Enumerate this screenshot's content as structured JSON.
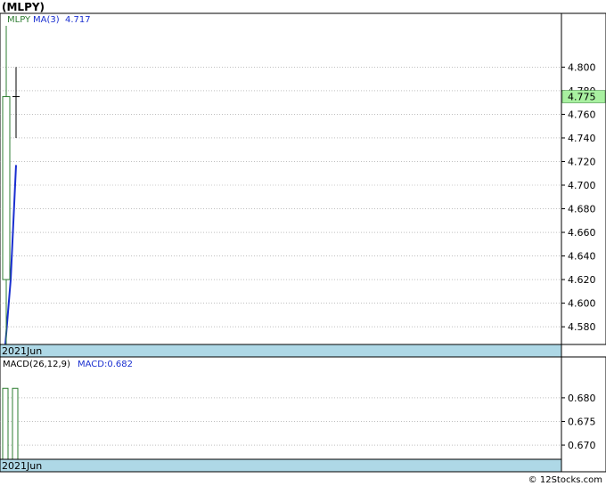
{
  "page_title": "(MLPY)",
  "footer_credit": "© 12Stocks.com",
  "colors": {
    "up_candle": "#2e7d32",
    "ma_line": "#1a2fd0",
    "date_band": "#aed8e6",
    "price_badge": "#a8f0a0",
    "grid": "#999999"
  },
  "chart_data": [
    {
      "type": "candlestick",
      "title": "",
      "legend": {
        "ticker": "MLPY",
        "ma_label": "MA(3)",
        "ma_value": "4.717"
      },
      "date_label": "2021Jun",
      "last_price_label": "4.775",
      "last_price": 4.775,
      "ylim": [
        4.565,
        4.835
      ],
      "y_ticks": [
        4.58,
        4.6,
        4.62,
        4.64,
        4.66,
        4.68,
        4.7,
        4.72,
        4.74,
        4.76,
        4.78,
        4.8
      ],
      "y_tick_labels": [
        "4.580",
        "4.600",
        "4.620",
        "4.640",
        "4.660",
        "4.680",
        "4.700",
        "4.720",
        "4.740",
        "4.760",
        "4.780",
        "4.800"
      ],
      "grid": true,
      "candles": [
        {
          "open": 4.62,
          "high": 4.835,
          "low": 4.565,
          "close": 4.775,
          "direction": "up"
        },
        {
          "open": 4.775,
          "high": 4.8,
          "low": 4.74,
          "close": 4.775,
          "direction": "flat"
        }
      ],
      "ma_series": [
        4.565,
        4.62,
        4.717
      ]
    },
    {
      "type": "bar",
      "title": "",
      "legend": {
        "macd_label": "MACD(26,12,9)",
        "macd_value_label": "MACD:0.682"
      },
      "date_label": "2021Jun",
      "ylim": [
        0.667,
        0.686
      ],
      "y_ticks": [
        0.67,
        0.675,
        0.68
      ],
      "y_tick_labels": [
        "0.670",
        "0.675",
        "0.680"
      ],
      "grid": true,
      "bars": [
        {
          "value": 0.682
        },
        {
          "value": 0.682
        }
      ]
    }
  ]
}
